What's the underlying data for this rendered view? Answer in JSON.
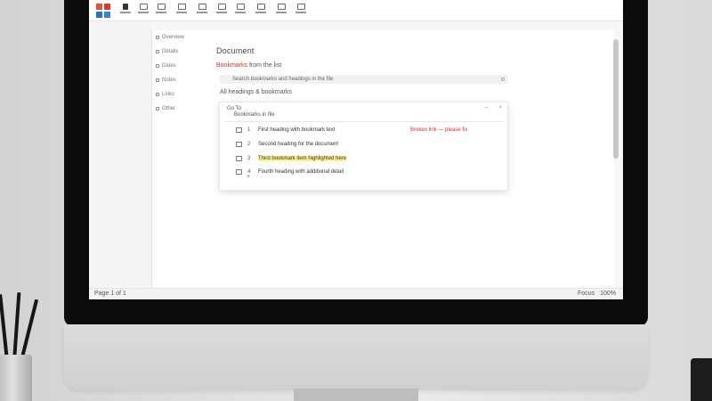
{
  "ribbon": {
    "buttons": [
      "file-icon",
      "home-icon",
      "insert-icon",
      "layout-icon",
      "references-icon",
      "review-icon",
      "view-icon",
      "help-icon",
      "share-icon"
    ]
  },
  "nav": {
    "items": [
      {
        "label": "Overview"
      },
      {
        "label": "Details"
      },
      {
        "label": "Dates"
      },
      {
        "label": "Notes"
      },
      {
        "label": "Links"
      },
      {
        "label": "Other"
      }
    ]
  },
  "document": {
    "heading": "Document",
    "subtitle_prefix": "Bookmarks",
    "subtitle_rest": " from the list",
    "search_text": "Search bookmarks and headings in the file",
    "filter_text": "All headings & bookmarks"
  },
  "dialog": {
    "title": "Go To",
    "subtitle": "Bookmarks in file",
    "close_label": "×",
    "min_label": "–",
    "rows": [
      {
        "num": "1",
        "text": "First heading with bookmark text",
        "note": "Broken link — please fix"
      },
      {
        "num": "2",
        "text": "Second heading for the document",
        "note": ""
      },
      {
        "num": "3",
        "text": "Third bookmark item highlighted here",
        "note": ""
      },
      {
        "num": "4",
        "text": "Fourth heading with additional detail",
        "note": ""
      }
    ],
    "extra": "+"
  },
  "status": {
    "left": "Page 1 of 1",
    "right": [
      "Focus",
      "100%"
    ]
  }
}
